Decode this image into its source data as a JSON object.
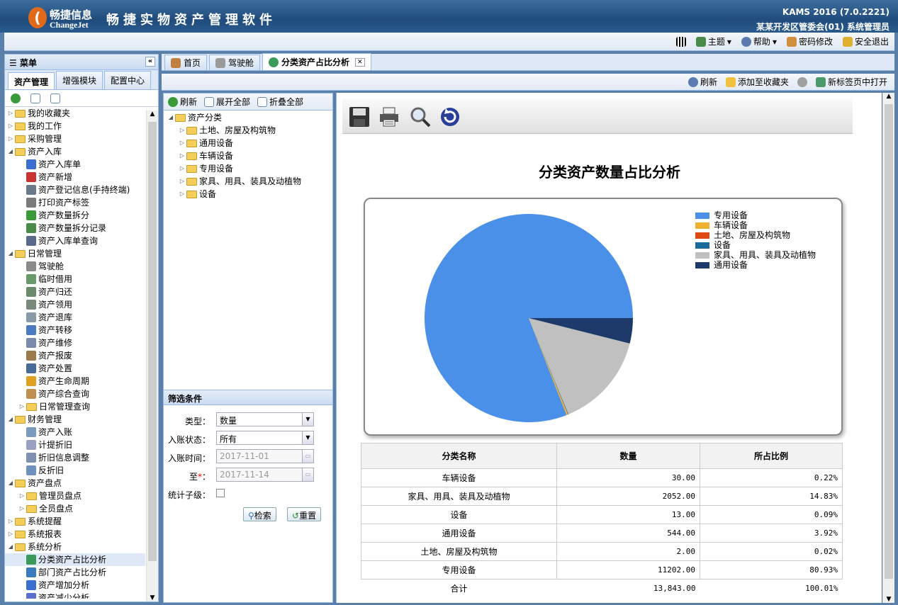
{
  "app": {
    "logo_cn": "畅捷信息",
    "logo_en": "ChangeJet",
    "title": "畅捷实物资产管理软件",
    "version": "KAMS 2016 (7.0.2221)",
    "org_user": "某某开发区管委会(01)  系统管理员"
  },
  "toolbar": {
    "theme": "主题",
    "help": "帮助",
    "password": "密码修改",
    "logout": "安全退出"
  },
  "menu": {
    "title": "菜单",
    "tabs": [
      "资产管理",
      "增强模块",
      "配置中心"
    ],
    "items": [
      {
        "label": "我的收藏夹",
        "type": "folder",
        "exp": "▷",
        "indent": 0
      },
      {
        "label": "我的工作",
        "type": "folder",
        "exp": "▷",
        "indent": 0
      },
      {
        "label": "采购管理",
        "type": "folder",
        "exp": "▷",
        "indent": 0
      },
      {
        "label": "资产入库",
        "type": "folder",
        "exp": "◢",
        "indent": 0
      },
      {
        "label": "资产入库单",
        "type": "leaf",
        "color": "#3a6fcf",
        "indent": 1
      },
      {
        "label": "资产新增",
        "type": "leaf",
        "color": "#cc3333",
        "indent": 1
      },
      {
        "label": "资产登记信息(手持终端)",
        "type": "leaf",
        "color": "#6a7a8a",
        "indent": 1
      },
      {
        "label": "打印资产标签",
        "type": "leaf",
        "color": "#7a7a7a",
        "indent": 1
      },
      {
        "label": "资产数量拆分",
        "type": "leaf",
        "color": "#3a9a3a",
        "indent": 1
      },
      {
        "label": "资产数量拆分记录",
        "type": "leaf",
        "color": "#4a8a4a",
        "indent": 1
      },
      {
        "label": "资产入库单查询",
        "type": "leaf",
        "color": "#5a6a8a",
        "indent": 1
      },
      {
        "label": "日常管理",
        "type": "folder",
        "exp": "◢",
        "indent": 0
      },
      {
        "label": "驾驶舱",
        "type": "leaf",
        "color": "#8a8a8a",
        "indent": 1
      },
      {
        "label": "临时借用",
        "type": "leaf",
        "color": "#6a9a6a",
        "indent": 1
      },
      {
        "label": "资产归还",
        "type": "leaf",
        "color": "#6a8a6a",
        "indent": 1
      },
      {
        "label": "资产领用",
        "type": "leaf",
        "color": "#7a8a7a",
        "indent": 1
      },
      {
        "label": "资产退库",
        "type": "leaf",
        "color": "#8a9aaa",
        "indent": 1
      },
      {
        "label": "资产转移",
        "type": "leaf",
        "color": "#4a7ac0",
        "indent": 1
      },
      {
        "label": "资产维修",
        "type": "leaf",
        "color": "#7a8aaa",
        "indent": 1
      },
      {
        "label": "资产报废",
        "type": "leaf",
        "color": "#9a7a4a",
        "indent": 1
      },
      {
        "label": "资产处置",
        "type": "leaf",
        "color": "#4a6a9a",
        "indent": 1
      },
      {
        "label": "资产生命周期",
        "type": "leaf",
        "color": "#e0a020",
        "indent": 1
      },
      {
        "label": "资产综合查询",
        "type": "leaf",
        "color": "#c09050",
        "indent": 1
      },
      {
        "label": "日常管理查询",
        "type": "folder",
        "exp": "▷",
        "indent": 1
      },
      {
        "label": "财务管理",
        "type": "folder",
        "exp": "◢",
        "indent": 0
      },
      {
        "label": "资产入账",
        "type": "leaf",
        "color": "#7a9ac0",
        "indent": 1
      },
      {
        "label": "计提折旧",
        "type": "leaf",
        "color": "#9aa0c0",
        "indent": 1
      },
      {
        "label": "折旧信息调整",
        "type": "leaf",
        "color": "#8090b0",
        "indent": 1
      },
      {
        "label": "反折旧",
        "type": "leaf",
        "color": "#7090c0",
        "indent": 1
      },
      {
        "label": "资产盘点",
        "type": "folder",
        "exp": "◢",
        "indent": 0
      },
      {
        "label": "管理员盘点",
        "type": "folder",
        "exp": "▷",
        "indent": 1
      },
      {
        "label": "全员盘点",
        "type": "folder",
        "exp": "▷",
        "indent": 1
      },
      {
        "label": "系统提醒",
        "type": "folder",
        "exp": "▷",
        "indent": 0
      },
      {
        "label": "系统报表",
        "type": "folder",
        "exp": "▷",
        "indent": 0
      },
      {
        "label": "系统分析",
        "type": "folder",
        "exp": "◢",
        "indent": 0
      },
      {
        "label": "分类资产占比分析",
        "type": "leaf",
        "color": "#3a9a5a",
        "indent": 1,
        "selected": true
      },
      {
        "label": "部门资产占比分析",
        "type": "leaf",
        "color": "#3a7ac0",
        "indent": 1
      },
      {
        "label": "资产增加分析",
        "type": "leaf",
        "color": "#3a6fcf",
        "indent": 1
      },
      {
        "label": "资产减少分析",
        "type": "leaf",
        "color": "#5a6fcf",
        "indent": 1
      }
    ]
  },
  "tabs": [
    {
      "label": "首页",
      "active": false
    },
    {
      "label": "驾驶舱",
      "active": false
    },
    {
      "label": "分类资产占比分析",
      "active": true
    }
  ],
  "subtoolbar": {
    "refresh": "刷新",
    "add_fav": "添加至收藏夹",
    "open_new": "新标签页中打开"
  },
  "category": {
    "refresh": "刷新",
    "expand_all": "展开全部",
    "collapse_all": "折叠全部",
    "root": "资产分类",
    "children": [
      "土地、房屋及构筑物",
      "通用设备",
      "车辆设备",
      "专用设备",
      "家具、用具、装具及动植物",
      "设备"
    ]
  },
  "filter": {
    "title": "筛选条件",
    "type_label": "类型：",
    "type_value": "数量",
    "status_label": "入账状态：",
    "status_value": "所有",
    "date_label": "入账时间：",
    "date_from": "2017-11-01",
    "to_label": "至",
    "required_mark": "*",
    "colon": "：",
    "date_to": "2017-11-14",
    "sub_label": "统计子级：",
    "search_btn": "检索",
    "reset_btn": "重置"
  },
  "chart_data": {
    "type": "pie",
    "title": "分类资产数量占比分析",
    "categories": [
      "专用设备",
      "车辆设备",
      "土地、房屋及构筑物",
      "设备",
      "家具、用具、装具及动植物",
      "通用设备"
    ],
    "values": [
      11202,
      30,
      2,
      13,
      2052,
      544
    ],
    "colors": [
      "#4a8fe8",
      "#f0b030",
      "#e04a10",
      "#1a6a9a",
      "#c0c0c0",
      "#1d3a6a"
    ],
    "legend": "top-right"
  },
  "table": {
    "headers": [
      "分类名称",
      "数量",
      "所占比例"
    ],
    "rows": [
      [
        "车辆设备",
        "30.00",
        "0.22%"
      ],
      [
        "家具、用具、装具及动植物",
        "2052.00",
        "14.83%"
      ],
      [
        "设备",
        "13.00",
        "0.09%"
      ],
      [
        "通用设备",
        "544.00",
        "3.92%"
      ],
      [
        "土地、房屋及构筑物",
        "2.00",
        "0.02%"
      ],
      [
        "专用设备",
        "11202.00",
        "80.93%"
      ]
    ],
    "total": [
      "合计",
      "13,843.00",
      "100.01%"
    ]
  }
}
